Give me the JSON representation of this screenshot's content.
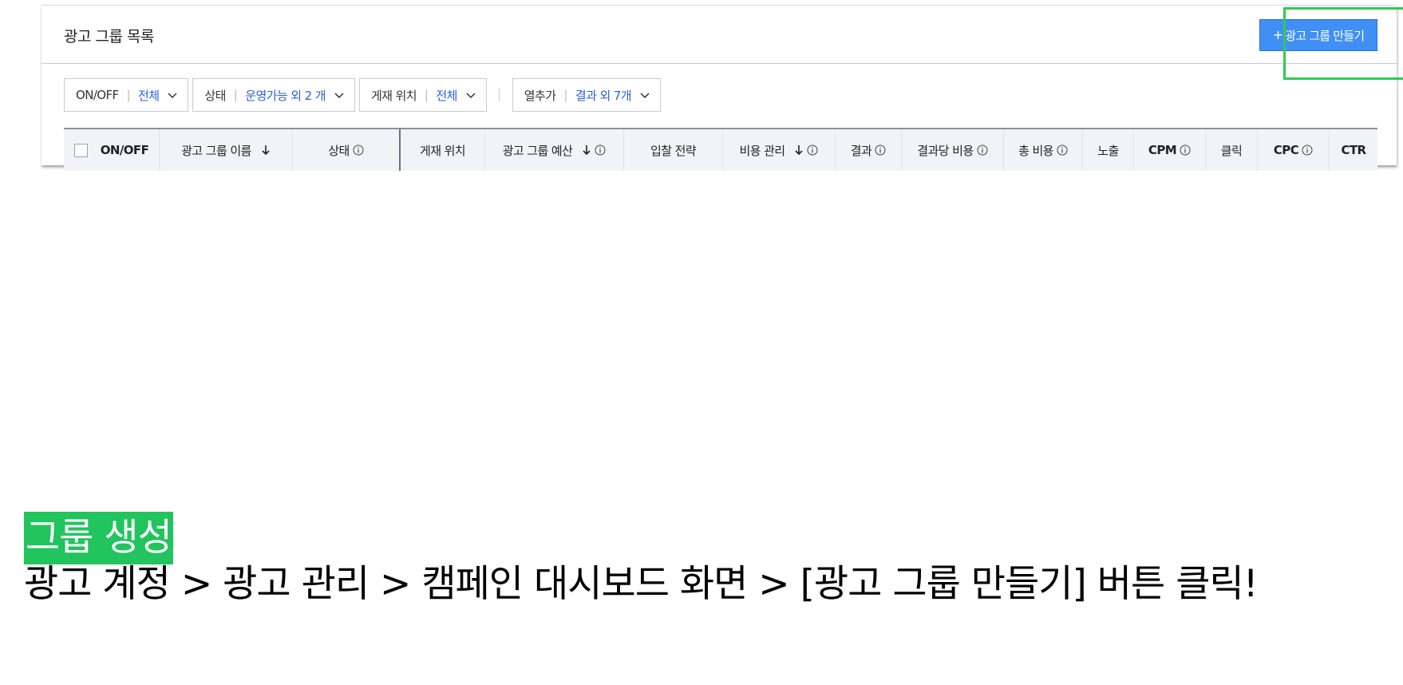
{
  "panel": {
    "title": "광고 그룹 목록",
    "create_button": {
      "icon": "plus-icon",
      "label": "광고 그룹 만들기",
      "highlight_color": "#2ecc4f",
      "background_color": "#3f8ff5"
    }
  },
  "filters": [
    {
      "label": "ON/OFF",
      "value": "전체"
    },
    {
      "label": "상태",
      "value": "운영가능 외 2 개"
    },
    {
      "label": "게재 위치",
      "value": "전체"
    },
    {
      "label": "열추가",
      "value": "결과 외 7개"
    }
  ],
  "table": {
    "columns": [
      {
        "label": "ON/OFF",
        "checkbox": true
      },
      {
        "label": "광고 그룹 이름",
        "sort": "desc"
      },
      {
        "label": "상태",
        "info": true
      },
      {
        "label": "게재 위치"
      },
      {
        "label": "광고 그룹 예산",
        "sort": "desc",
        "info": true
      },
      {
        "label": "입찰 전략"
      },
      {
        "label": "비용 관리",
        "sort": "desc",
        "info": true
      },
      {
        "label": "결과",
        "info": true
      },
      {
        "label": "결과당 비용",
        "info": true
      },
      {
        "label": "총 비용",
        "info": true
      },
      {
        "label": "노출"
      },
      {
        "label": "CPM",
        "info": true
      },
      {
        "label": "클릭"
      },
      {
        "label": "CPC",
        "info": true
      },
      {
        "label": "CTR"
      }
    ]
  },
  "caption": {
    "title": "그룹 생성",
    "title_bg": "#21c45d",
    "body": "광고 계정 > 광고 관리 > 캠페인 대시보드 화면 > [광고 그룹 만들기] 버튼 클릭!"
  }
}
